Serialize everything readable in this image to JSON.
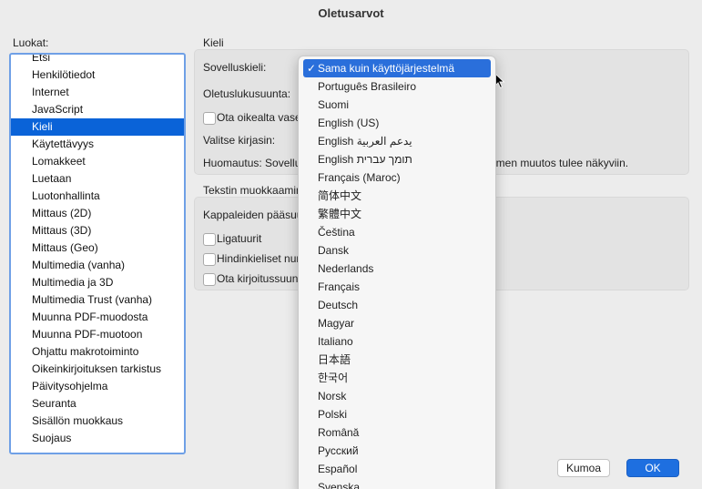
{
  "window": {
    "title": "Oletusarvot"
  },
  "sidebar": {
    "label": "Luokat:",
    "items": [
      "Etsi",
      "Henkilötiedot",
      "Internet",
      "JavaScript",
      "Kieli",
      "Käytettävyys",
      "Lomakkeet",
      "Luetaan",
      "Luotonhallinta",
      "Mittaus (2D)",
      "Mittaus (3D)",
      "Mittaus (Geo)",
      "Multimedia (vanha)",
      "Multimedia ja 3D",
      "Multimedia Trust (vanha)",
      "Muunna PDF-muodosta",
      "Muunna PDF-muotoon",
      "Ohjattu makrotoiminto",
      "Oikeinkirjoituksen tarkistus",
      "Päivitysohjelma",
      "Seuranta",
      "Sisällön muokkaus",
      "Suojaus"
    ],
    "selected": "Kieli"
  },
  "language_section": {
    "title": "Kieli",
    "app_language_label": "Sovelluskieli:",
    "default_reading_label": "Oletuslukusuunta:",
    "rtl_checkbox_label": "Ota oikealta vase",
    "choose_font_label": "Valitse kirjasin:",
    "note_text": "Huomautus: Sovellu",
    "note_suffix": "imen muutos tulee näkyviin."
  },
  "text_editing_section": {
    "title": "Tekstin muokkaamin",
    "paragraph_label": "Kappaleiden pääsuu",
    "ligatures_label": "Ligatuurit",
    "hindi_label": "Hindinkieliset nur",
    "spellcheck_label": "Ota kirjoitussuun"
  },
  "dropdown": {
    "selected": "Sama kuin käyttöjärjestelmä",
    "options": [
      "Sama kuin käyttöjärjestelmä",
      "Português Brasileiro",
      "Suomi",
      "English (US)",
      "English يدعم العربية",
      "English תומך עברית",
      "Français (Maroc)",
      "简体中文",
      "繁體中文",
      "Čeština",
      "Dansk",
      "Nederlands",
      "Français",
      "Deutsch",
      "Magyar",
      "Italiano",
      "日本語",
      "한국어",
      "Norsk",
      "Polski",
      "Română",
      "Русский",
      "Español",
      "Svenska"
    ]
  },
  "buttons": {
    "cancel": "Kumoa",
    "ok": "OK"
  }
}
